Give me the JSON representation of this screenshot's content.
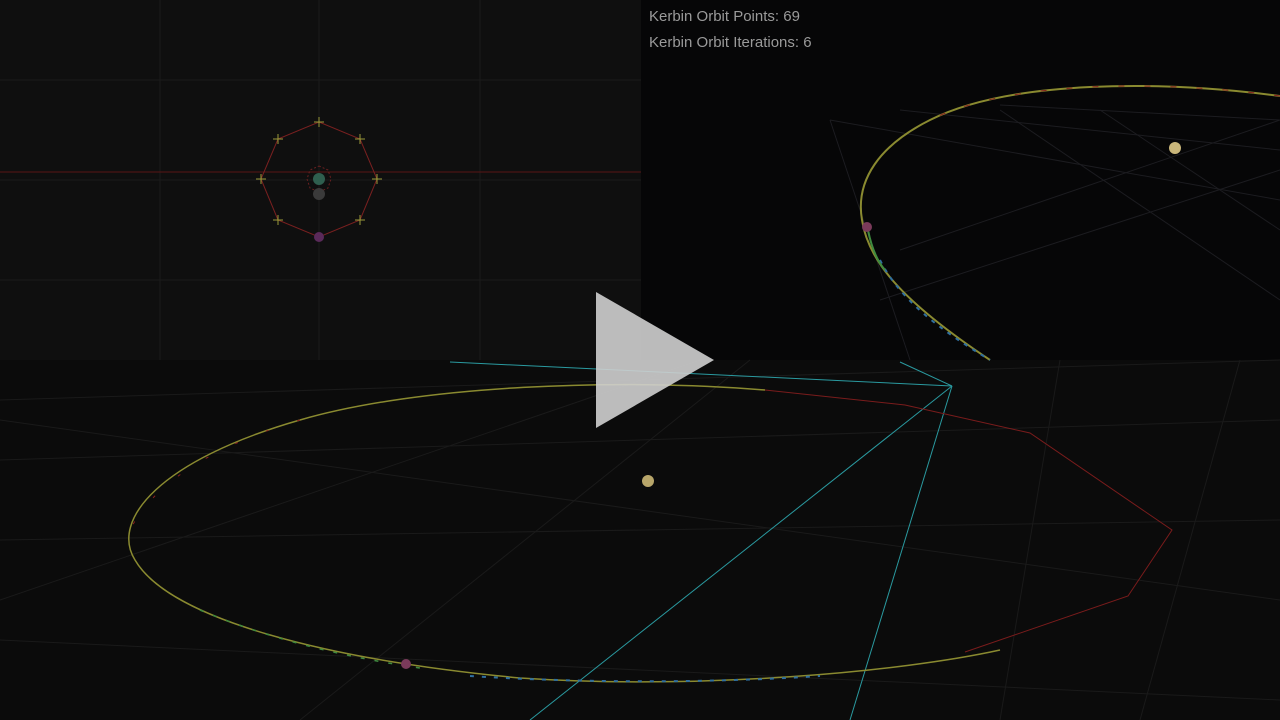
{
  "hud": {
    "points_label": "Kerbin Orbit Points: 69",
    "iterations_label": "Kerbin Orbit Iterations: 6"
  },
  "overlay": {
    "play_icon": "play-icon"
  },
  "colors": {
    "background": "#0b0b0b",
    "top_left_panel": "#0f0f0f",
    "top_right_panel": "#060607",
    "grid": "#2a2a2a",
    "orbit_red": "#9b1f1f",
    "orbit_yellow": "#a8a83a",
    "orbit_green": "#3f9a3f",
    "orbit_blue": "#2f7fbf",
    "cyan_frustum": "#2a9aa0",
    "sun": "#c9b67a",
    "planet_marker": "#7a3a5a",
    "play_fill": "#cfcfcf"
  }
}
